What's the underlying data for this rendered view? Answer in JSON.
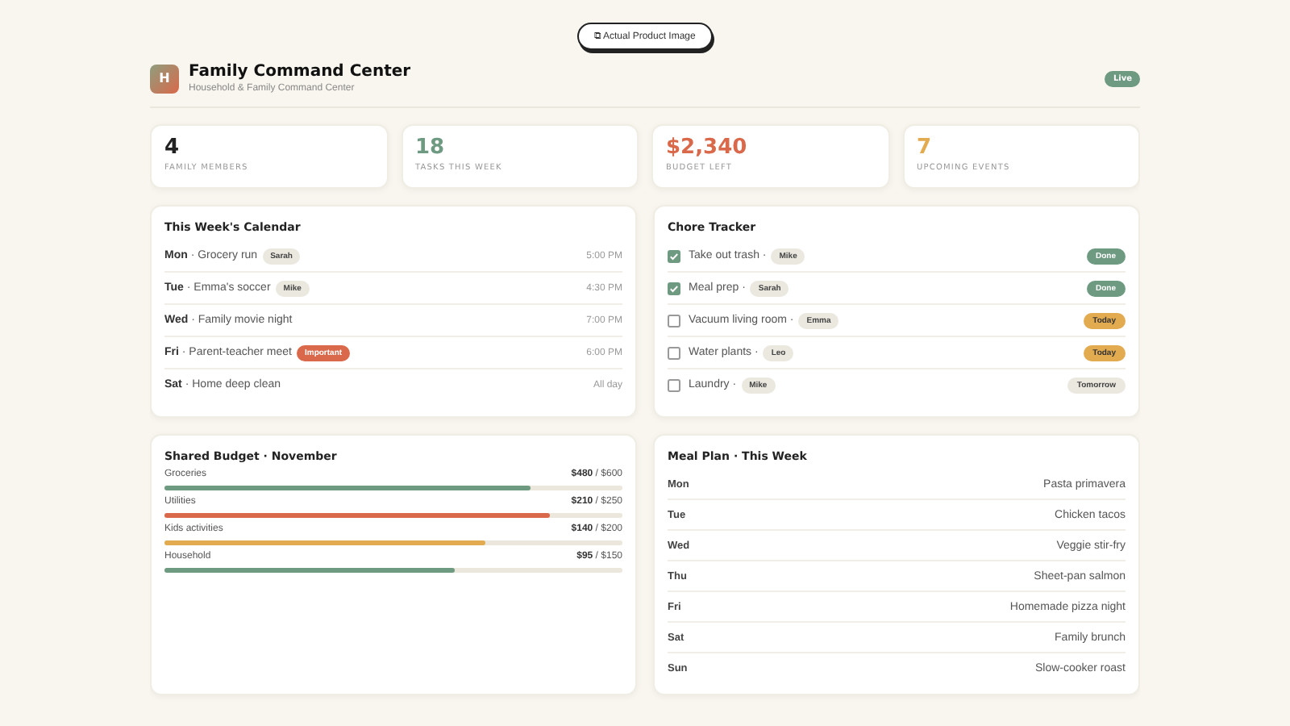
{
  "top_button": "⧉ Actual Product Image",
  "header": {
    "logo": "H",
    "title": "Family Command Center",
    "subtitle": "Household & Family Command Center",
    "badge": "Live"
  },
  "stats": [
    {
      "value": "4",
      "label": "FAMILY MEMBERS",
      "color": "#222222"
    },
    {
      "value": "18",
      "label": "TASKS THIS WEEK",
      "color": "#6f9a82"
    },
    {
      "value": "$2,340",
      "label": "BUDGET LEFT",
      "color": "#d9694a"
    },
    {
      "value": "7",
      "label": "UPCOMING EVENTS",
      "color": "#e3ab50"
    }
  ],
  "calendar": {
    "title": "This Week's Calendar",
    "rows": [
      {
        "day": "Mon",
        "event": "· Grocery run",
        "tag": {
          "text": "Sarah",
          "kind": "person"
        },
        "time": "5:00 PM"
      },
      {
        "day": "Tue",
        "event": "· Emma's soccer",
        "tag": {
          "text": "Mike",
          "kind": "person"
        },
        "time": "4:30 PM"
      },
      {
        "day": "Wed",
        "event": "· Family movie night",
        "time": "7:00 PM"
      },
      {
        "day": "Fri",
        "event": "· Parent-teacher meet",
        "tag": {
          "text": "Important",
          "kind": "important"
        },
        "time": "6:00 PM"
      },
      {
        "day": "Sat",
        "event": "· Home deep clean",
        "time": "All day"
      }
    ]
  },
  "chores": {
    "title": "Chore Tracker",
    "rows": [
      {
        "task": "Take out trash ·",
        "person": "Mike",
        "checked": true,
        "status": "Done",
        "kind": "done"
      },
      {
        "task": "Meal prep ·",
        "person": "Sarah",
        "checked": true,
        "status": "Done",
        "kind": "done"
      },
      {
        "task": "Vacuum living room ·",
        "person": "Emma",
        "checked": false,
        "status": "Today",
        "kind": "today"
      },
      {
        "task": "Water plants ·",
        "person": "Leo",
        "checked": false,
        "status": "Today",
        "kind": "today"
      },
      {
        "task": "Laundry ·",
        "person": "Mike",
        "checked": false,
        "status": "Tomorrow",
        "kind": "tomorrow"
      }
    ]
  },
  "budget": {
    "title": "Shared Budget · November",
    "rows": [
      {
        "name": "Groceries",
        "spent": "$480",
        "limit": "/ $600",
        "level": 0.8,
        "color": "#6f9a82"
      },
      {
        "name": "Utilities",
        "spent": "$210",
        "limit": "/ $250",
        "level": 0.84,
        "color": "#d9694a"
      },
      {
        "name": "Kids activities",
        "spent": "$140",
        "limit": "/ $200",
        "level": 0.7,
        "color": "#e3ab50"
      },
      {
        "name": "Household",
        "spent": "$95",
        "limit": "/ $150",
        "level": 0.633,
        "color": "#6f9a82"
      }
    ]
  },
  "meals": {
    "title": "Meal Plan · This Week",
    "rows": [
      {
        "day": "Mon",
        "meal": "Pasta primavera"
      },
      {
        "day": "Tue",
        "meal": "Chicken tacos"
      },
      {
        "day": "Wed",
        "meal": "Veggie stir-fry"
      },
      {
        "day": "Thu",
        "meal": "Sheet-pan salmon"
      },
      {
        "day": "Fri",
        "meal": "Homemade pizza night"
      },
      {
        "day": "Sat",
        "meal": "Family brunch"
      },
      {
        "day": "Sun",
        "meal": "Slow-cooker roast"
      }
    ]
  }
}
